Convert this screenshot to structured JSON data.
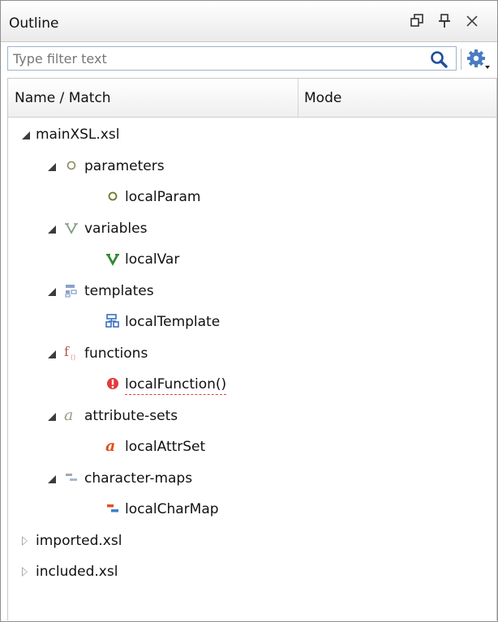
{
  "window": {
    "title": "Outline"
  },
  "filter": {
    "placeholder": "Type filter text",
    "value": ""
  },
  "table": {
    "columns": [
      "Name / Match",
      "Mode"
    ]
  },
  "tree": {
    "root": {
      "label": "mainXSL.xsl",
      "expanded": true
    },
    "groups": [
      {
        "label": "parameters",
        "icon": "parameter-icon",
        "expanded": true,
        "child": {
          "label": "localParam",
          "icon": "parameter-icon"
        }
      },
      {
        "label": "variables",
        "icon": "variable-icon",
        "expanded": true,
        "child": {
          "label": "localVar",
          "icon": "variable-icon"
        }
      },
      {
        "label": "templates",
        "icon": "template-icon",
        "expanded": true,
        "child": {
          "label": "localTemplate",
          "icon": "template-icon"
        }
      },
      {
        "label": "functions",
        "icon": "function-icon",
        "expanded": true,
        "child": {
          "label": "localFunction()",
          "icon": "error-icon",
          "has_error": true
        }
      },
      {
        "label": "attribute-sets",
        "icon": "attribute-set-icon",
        "expanded": true,
        "child": {
          "label": "localAttrSet",
          "icon": "attribute-set-icon"
        }
      },
      {
        "label": "character-maps",
        "icon": "character-map-icon",
        "expanded": true,
        "child": {
          "label": "localCharMap",
          "icon": "character-map-icon"
        }
      }
    ],
    "other_files": [
      {
        "label": "imported.xsl",
        "expanded": false
      },
      {
        "label": "included.xsl",
        "expanded": false
      }
    ]
  },
  "colors": {
    "error": "#e23b3b",
    "variable": "#2f8a2f",
    "template": "#3a6fbf",
    "function": "#b05a4a",
    "attribute": "#e0501e"
  }
}
